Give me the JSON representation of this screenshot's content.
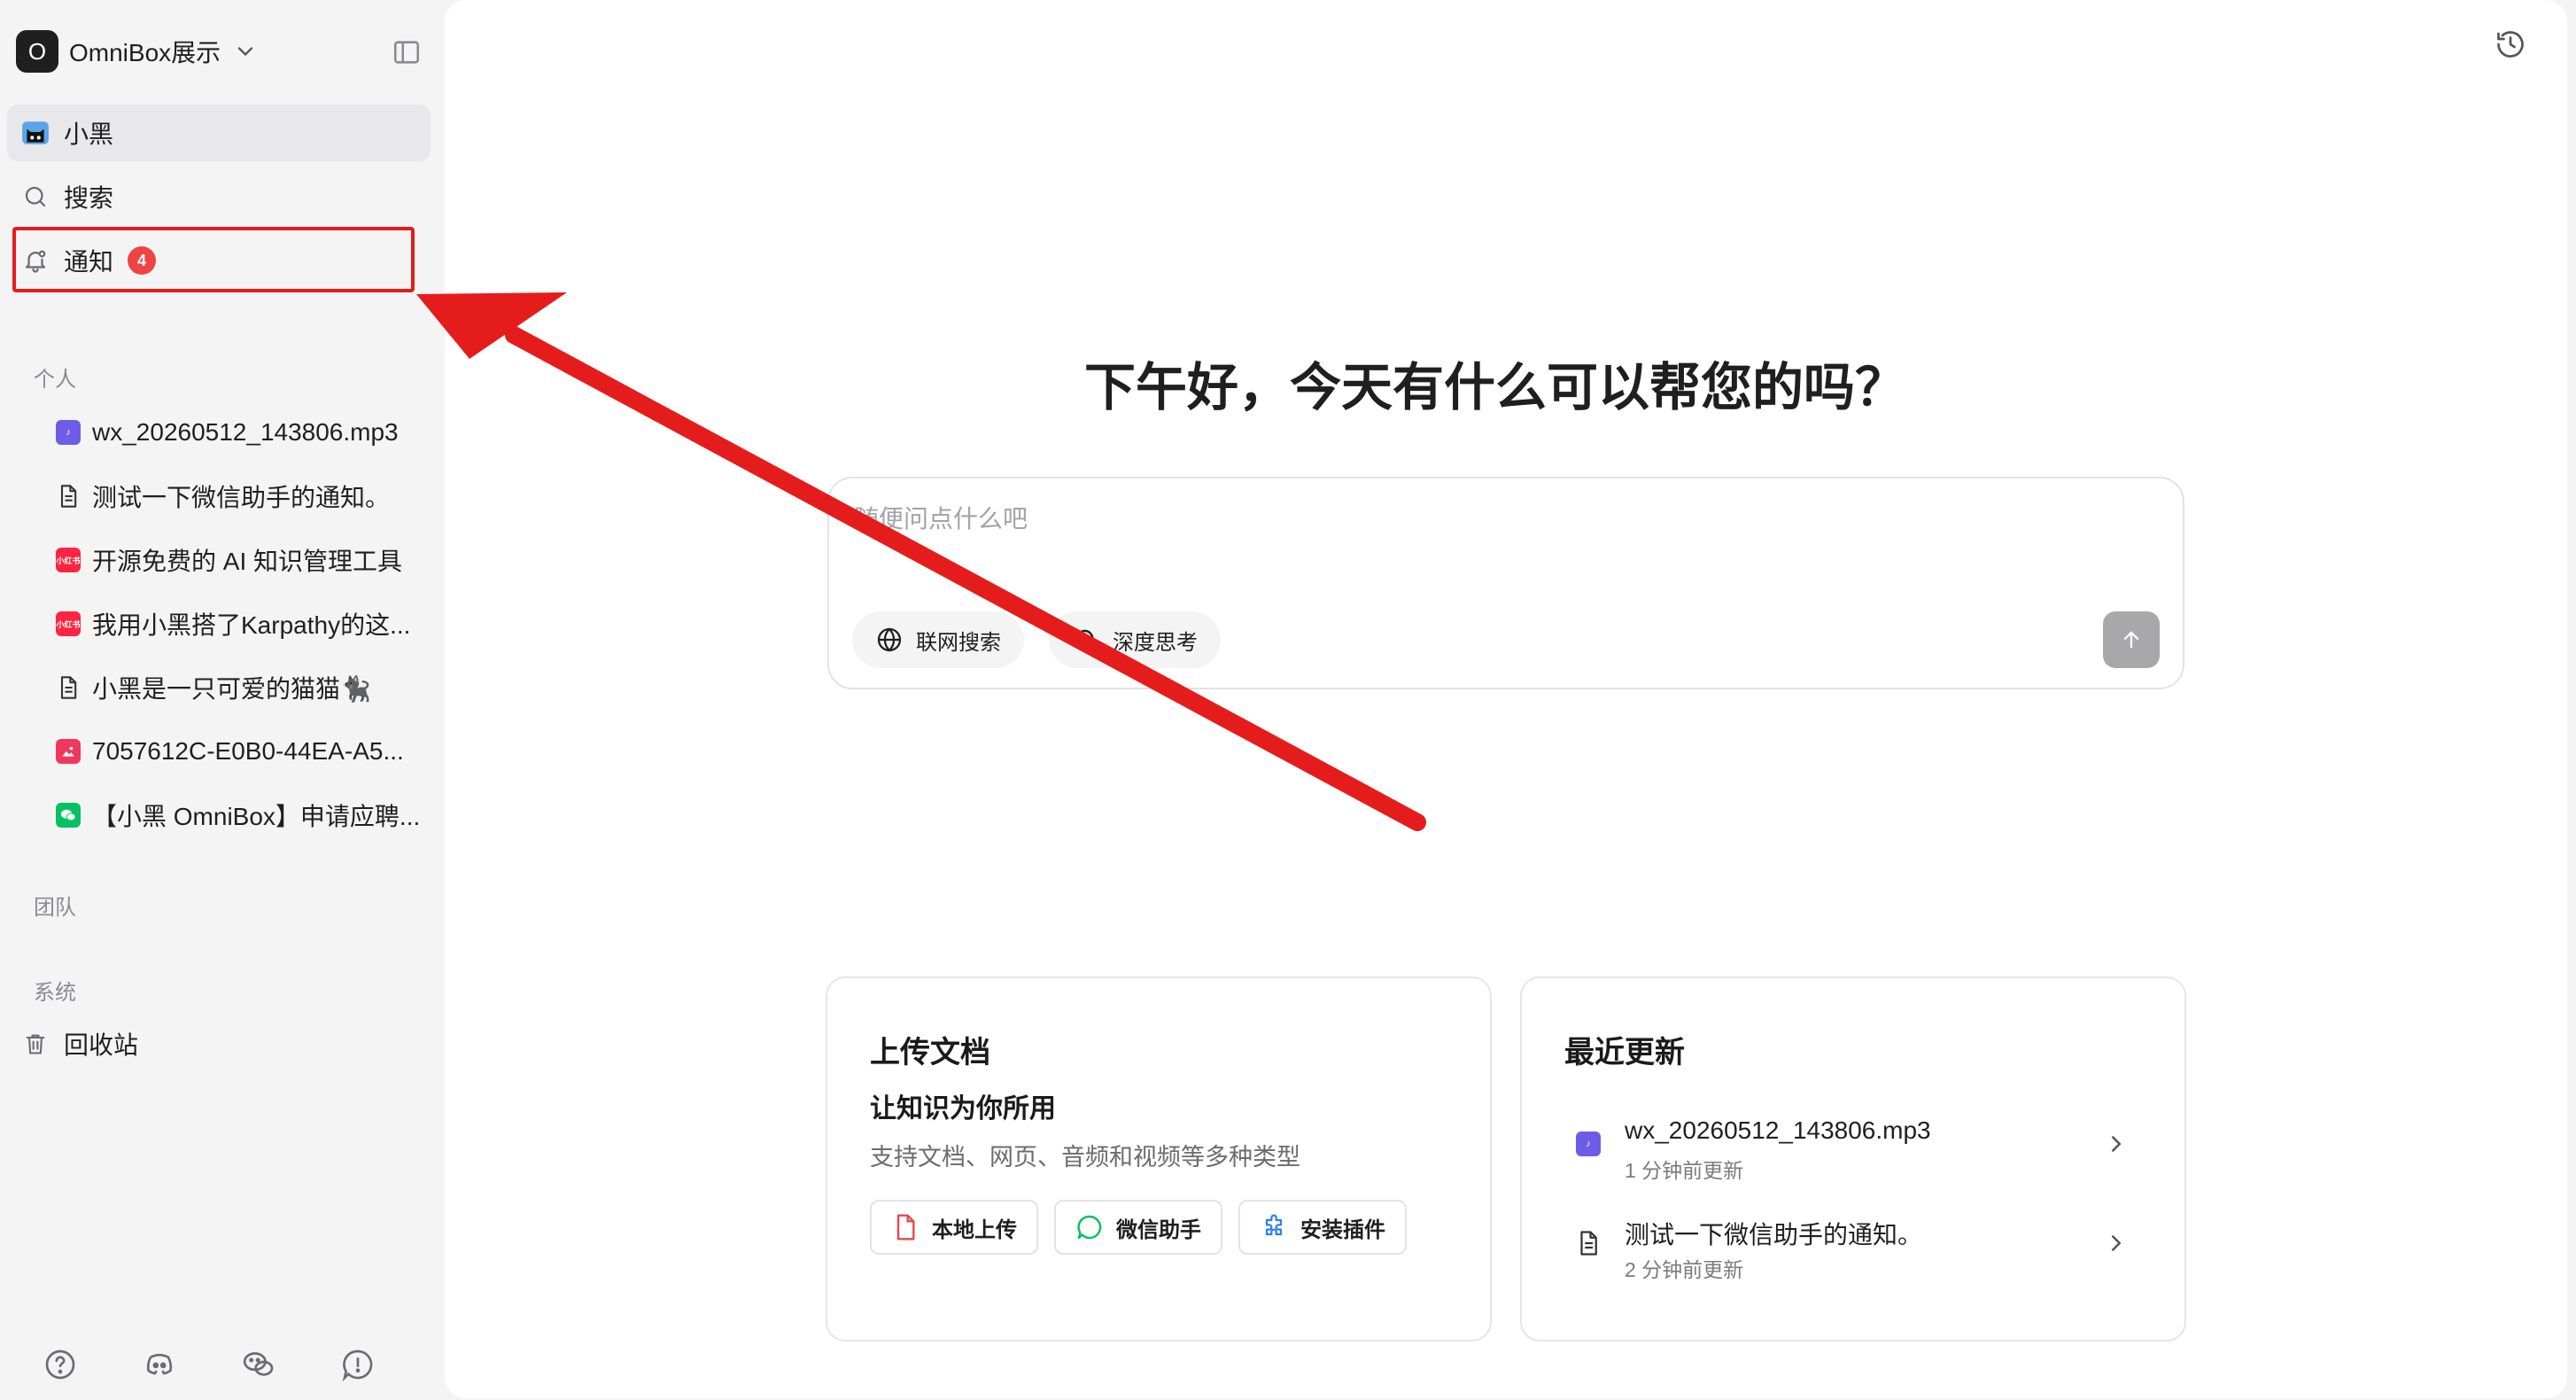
{
  "workspace": {
    "avatar_letter": "O",
    "name": "OmniBox展示"
  },
  "nav": {
    "home_label": "小黑",
    "search_label": "搜索",
    "notifications_label": "通知",
    "notifications_count": "4"
  },
  "sections": {
    "personal": "个人",
    "team": "团队",
    "system": "系统"
  },
  "personal_items": [
    {
      "label": "wx_20260512_143806.mp3",
      "icon": "audio-file-icon"
    },
    {
      "label": "测试一下微信助手的通知。",
      "icon": "document-icon"
    },
    {
      "label": "开源免费的 AI 知识管理工具",
      "icon": "xiaohongshu-icon"
    },
    {
      "label": "我用小黑搭了Karpathy的这...",
      "icon": "xiaohongshu-icon"
    },
    {
      "label": "小黑是一只可爱的猫猫🐈‍⬛",
      "icon": "document-icon"
    },
    {
      "label": "7057612C-E0B0-44EA-A5...",
      "icon": "image-file-icon"
    },
    {
      "label": "【小黑 OmniBox】申请应聘...",
      "icon": "wechat-icon"
    }
  ],
  "xiaohongshu_tile_text": "小红书",
  "trash_label": "回收站",
  "main": {
    "greeting": "下午好，今天有什么可以帮您的吗？",
    "composer_placeholder": "随便问点什么吧",
    "web_search_label": "联网搜索",
    "deep_think_label": "深度思考"
  },
  "upload_card": {
    "title": "上传文档",
    "subtitle": "让知识为你所用",
    "description": "支持文档、网页、音频和视频等多种类型",
    "local_upload": "本地上传",
    "wechat_assistant": "微信助手",
    "install_plugin": "安装插件"
  },
  "recent_card": {
    "title": "最近更新",
    "items": [
      {
        "name": "wx_20260512_143806.mp3",
        "time": "1 分钟前更新",
        "icon": "audio-file-icon"
      },
      {
        "name": "测试一下微信助手的通知。",
        "time": "2 分钟前更新",
        "icon": "document-icon"
      }
    ]
  },
  "colors": {
    "accent_red": "#e51c1c",
    "badge_red": "#ef4444",
    "audio_purple": "#6d5ce8",
    "xiaohongshu_red": "#ff2442",
    "wechat_green": "#07c160"
  }
}
